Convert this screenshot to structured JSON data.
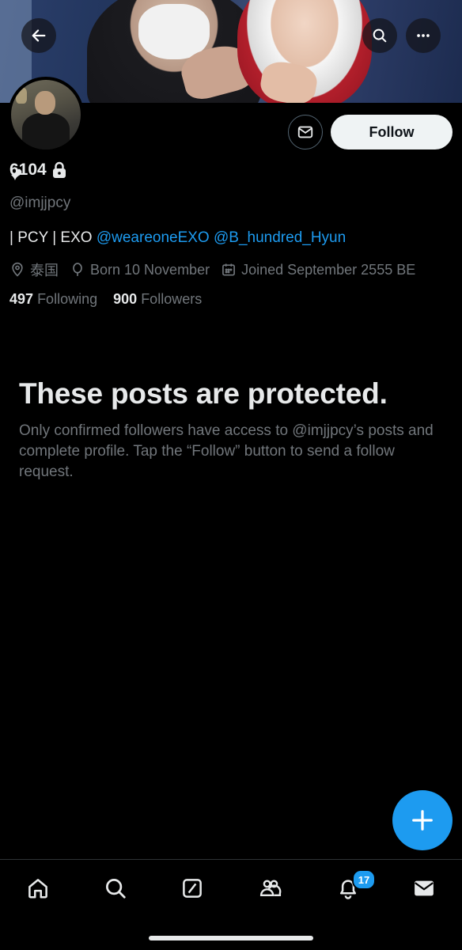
{
  "profile": {
    "display_name": "6104",
    "handle": "@imjjpcy",
    "bio_prefix": "| PCY | EXO ",
    "bio_mention_1": "@weareoneEXO",
    "bio_mention_2": "@B_hundred_Hyun",
    "location": "泰国",
    "birthday": "Born 10 November",
    "joined": "Joined September 2555 BE",
    "following_count": "497",
    "following_label": "Following",
    "followers_count": "900",
    "followers_label": "Followers",
    "protected_account": true
  },
  "actions": {
    "follow_label": "Follow"
  },
  "protected_notice": {
    "title": "These posts are protected.",
    "body": "Only confirmed followers have access to @imjjpcy’s posts and complete profile. Tap the “Follow” button to send a follow request."
  },
  "header_buttons": [
    "back-arrow-icon",
    "search-icon",
    "more-icon"
  ],
  "bottom_nav": {
    "items": [
      "home-icon",
      "search-icon",
      "grok-icon",
      "communities-icon",
      "notifications-icon",
      "messages-icon"
    ],
    "notifications_badge": "17"
  },
  "colors": {
    "background": "#000000",
    "accent": "#1d9bf0",
    "text_primary": "#e7e9ea",
    "text_secondary": "#71767b"
  }
}
